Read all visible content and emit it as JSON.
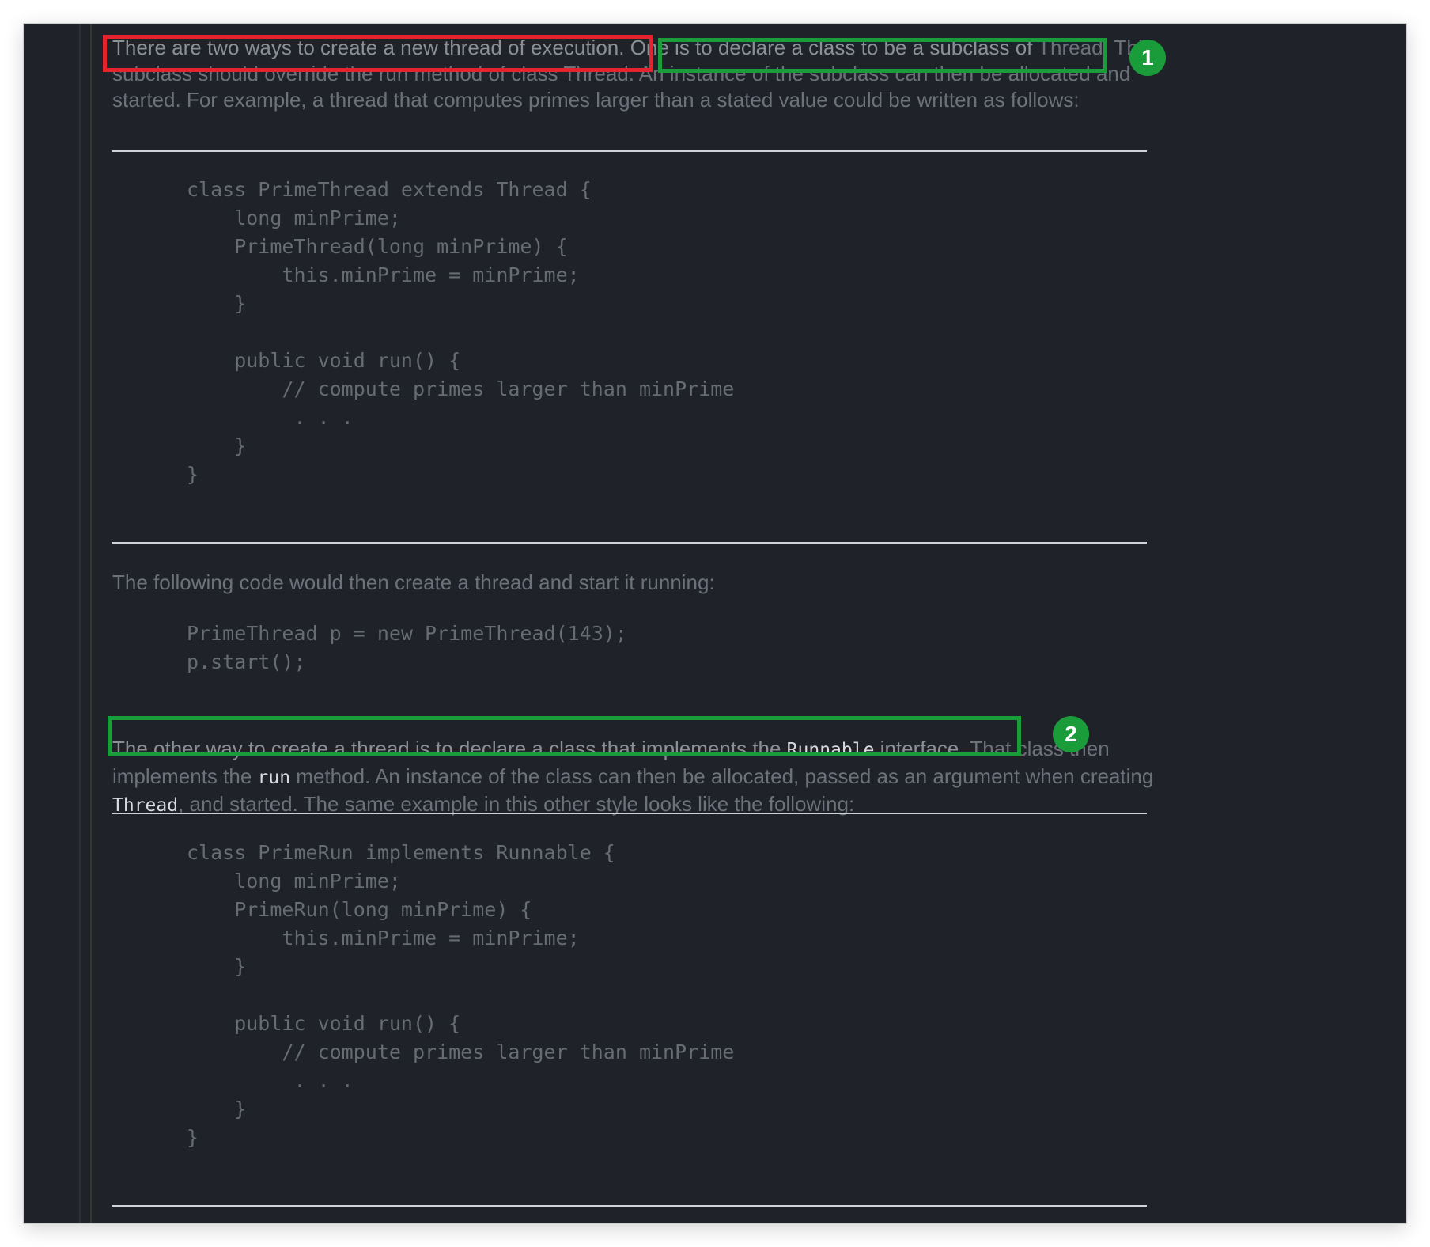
{
  "doc": {
    "p1": {
      "s1": "There are two ways to create a new thread of execution.",
      "s2": " One is to declare a class to be a subclass of",
      "rest": " Thread. This subclass should override the run method of class Thread. An instance of the subclass can then be allocated and started. For example, a thread that computes primes larger than a stated value could be written as follows:"
    },
    "code1": "class PrimeThread extends Thread {\n    long minPrime;\n    PrimeThread(long minPrime) {\n        this.minPrime = minPrime;\n    }\n\n    public void run() {\n        // compute primes larger than minPrime\n         . . .\n    }\n}",
    "p2": "The following code would then create a thread and start it running:",
    "code2": "PrimeThread p = new PrimeThread(143);\np.start();",
    "p3": {
      "s1": "The other way to create a thread is to declare a class that implements the ",
      "code_runnable": "Runnable",
      "s1_end": " interface.",
      "s2a": " That class then implements the ",
      "code_run": "run",
      "s2b": " method. An instance of the class can then be allocated, passed as an argument when creating ",
      "code_thread": "Thread",
      "s2c": ", and started. The same example in this other style looks like the following:"
    },
    "code3": "class PrimeRun implements Runnable {\n    long minPrime;\n    PrimeRun(long minPrime) {\n        this.minPrime = minPrime;\n    }\n\n    public void run() {\n        // compute primes larger than minPrime\n         . . .\n    }\n}"
  },
  "annotations": {
    "badge1": "1",
    "badge2": "2",
    "red_color": "#e5232e",
    "green_color": "#1a9c3a"
  }
}
